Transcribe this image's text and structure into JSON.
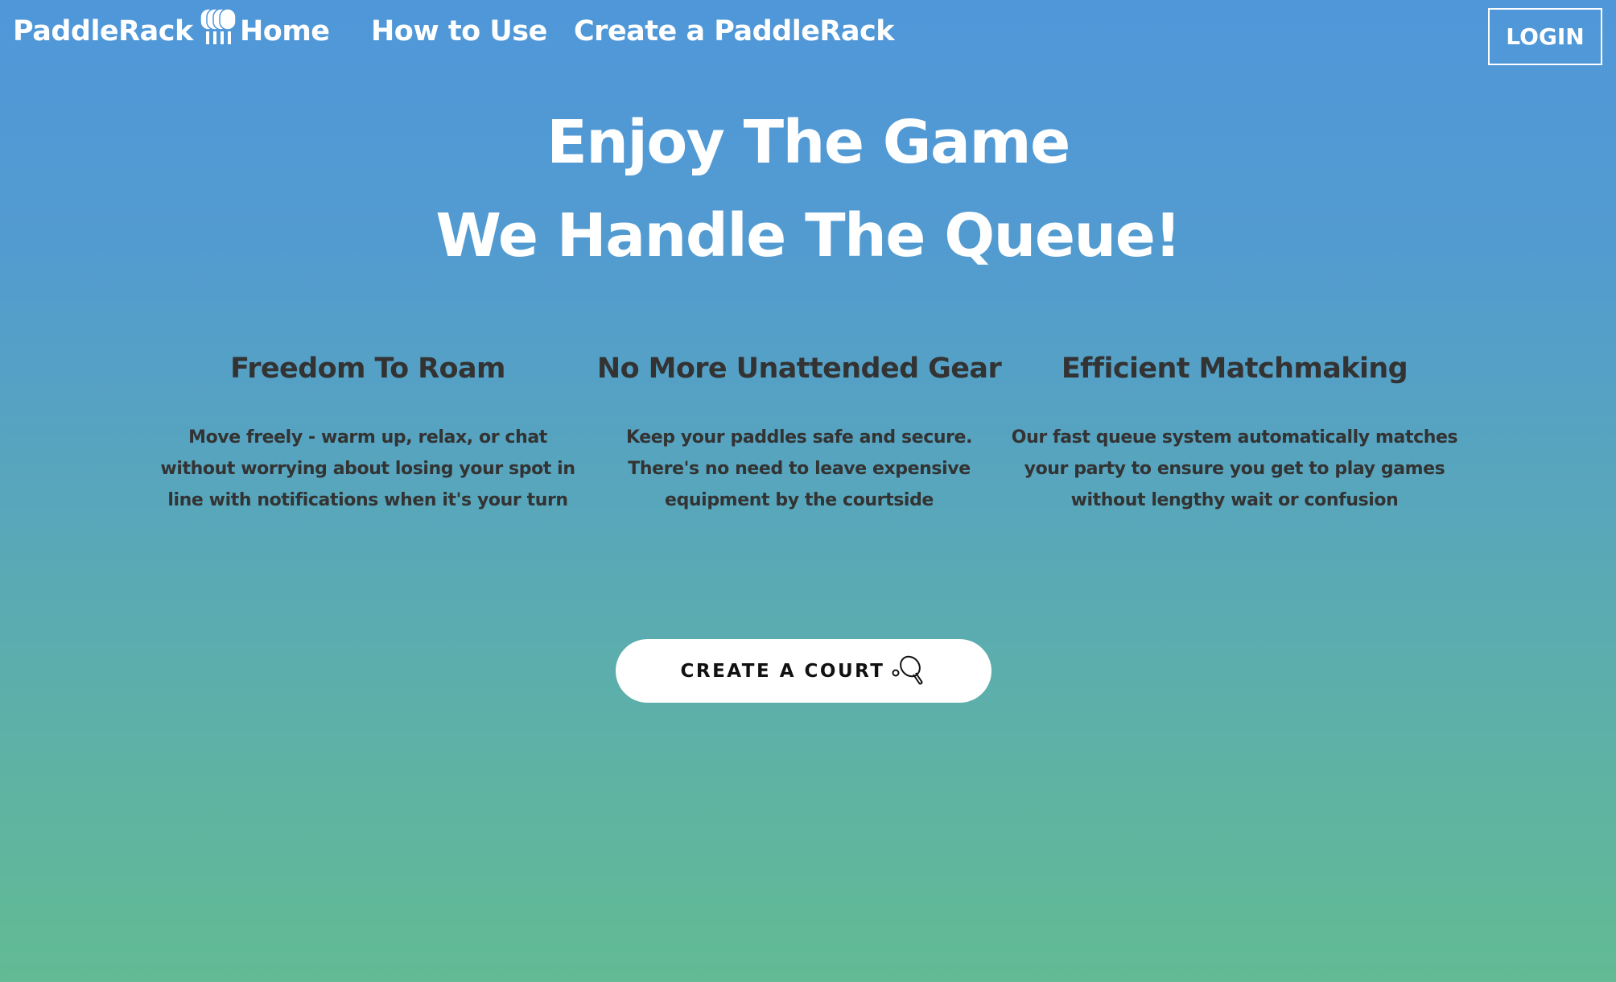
{
  "nav": {
    "brand": "PaddleRack",
    "brand_icon": "paddle-rack-logo-icon",
    "links": [
      {
        "label": "Home"
      },
      {
        "label": "How to Use"
      },
      {
        "label": "Create a PaddleRack"
      }
    ],
    "login_label": "LOGIN"
  },
  "hero": {
    "line1": "Enjoy The Game",
    "line2": "We Handle The Queue!"
  },
  "features": [
    {
      "title": "Freedom To Roam",
      "text": "Move freely - warm up, relax, or chat without worrying about losing your spot in line with notifications when it's your turn"
    },
    {
      "title": "No More Unattended Gear",
      "text": "Keep your paddles safe and secure. There's no need to leave expensive equipment by the courtside"
    },
    {
      "title": "Efficient Matchmaking",
      "text": "Our fast queue system automatically matches your party to ensure you get to play games without lengthy wait or confusion"
    }
  ],
  "cta": {
    "label": "CREATE A COURT",
    "icon": "pickleball-paddle-icon"
  },
  "colors": {
    "gradient_top": "#4f97d9",
    "gradient_bottom": "#62bb94",
    "heading_text": "#333333",
    "white": "#ffffff"
  }
}
